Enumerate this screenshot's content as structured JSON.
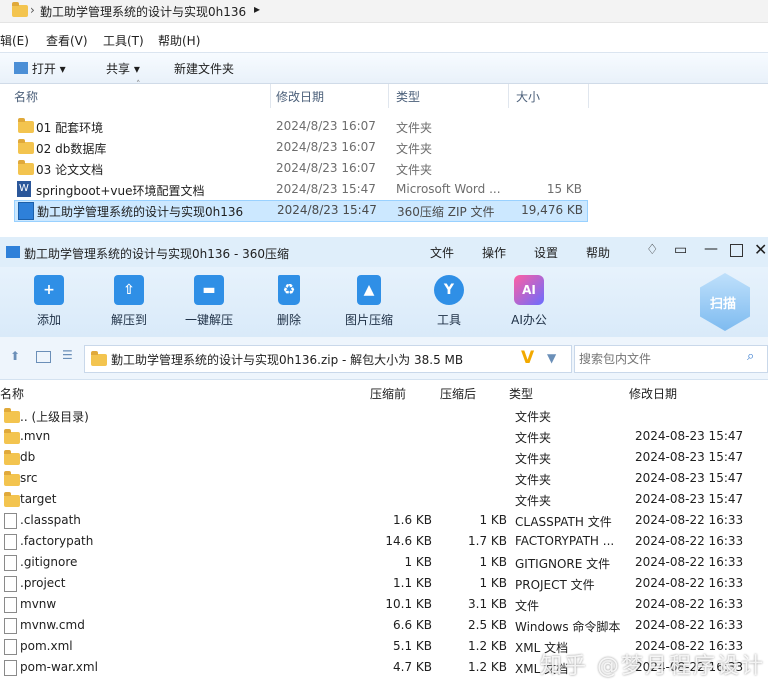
{
  "explorer": {
    "breadcrumb": "勤工助学管理系统的设计与实现0h136",
    "menu": [
      "辑(E)",
      "查看(V)",
      "工具(T)",
      "帮助(H)"
    ],
    "toolbar": {
      "open": "打开",
      "share": "共享",
      "new_folder": "新建文件夹"
    },
    "columns": {
      "name": "名称",
      "date": "修改日期",
      "type": "类型",
      "size": "大小"
    },
    "rows": [
      {
        "name": "01 配套环境",
        "date": "2024/8/23 16:07",
        "type": "文件夹",
        "size": ""
      },
      {
        "name": "02 db数据库",
        "date": "2024/8/23 16:07",
        "type": "文件夹",
        "size": ""
      },
      {
        "name": "03 论文文档",
        "date": "2024/8/23 16:07",
        "type": "文件夹",
        "size": ""
      },
      {
        "name": "springboot+vue环境配置文档",
        "date": "2024/8/23 15:47",
        "type": "Microsoft Word ...",
        "size": "15 KB"
      },
      {
        "name": "勤工助学管理系统的设计与实现0h136",
        "date": "2024/8/23 15:47",
        "type": "360压缩 ZIP 文件",
        "size": "19,476 KB"
      }
    ]
  },
  "zip": {
    "title": "勤工助学管理系统的设计与实现0h136 - 360压缩",
    "menu": {
      "file": "文件",
      "ops": "操作",
      "settings": "设置",
      "help": "帮助"
    },
    "scan": "扫描",
    "ribbon": [
      {
        "label": "添加",
        "icon": "add-icon"
      },
      {
        "label": "解压到",
        "icon": "extract-icon"
      },
      {
        "label": "一键解压",
        "icon": "oneclick-icon"
      },
      {
        "label": "删除",
        "icon": "delete-icon"
      },
      {
        "label": "图片压缩",
        "icon": "image-compress-icon"
      },
      {
        "label": "工具",
        "icon": "tools-icon"
      },
      {
        "label": "AI办公",
        "icon": "ai-icon"
      }
    ],
    "path": "勤工助学管理系统的设计与实现0h136.zip - 解包大小为 38.5 MB",
    "search_placeholder": "搜索包内文件",
    "columns": {
      "name": "名称",
      "packed": "压缩前",
      "compressed": "压缩后",
      "type": "类型",
      "date": "修改日期"
    },
    "rows": [
      {
        "name": ".. (上级目录)",
        "packed": "",
        "compressed": "",
        "type": "文件夹",
        "date": "",
        "kind": "folder"
      },
      {
        "name": ".mvn",
        "packed": "",
        "compressed": "",
        "type": "文件夹",
        "date": "2024-08-23 15:47",
        "kind": "folder"
      },
      {
        "name": "db",
        "packed": "",
        "compressed": "",
        "type": "文件夹",
        "date": "2024-08-23 15:47",
        "kind": "folder"
      },
      {
        "name": "src",
        "packed": "",
        "compressed": "",
        "type": "文件夹",
        "date": "2024-08-23 15:47",
        "kind": "folder"
      },
      {
        "name": "target",
        "packed": "",
        "compressed": "",
        "type": "文件夹",
        "date": "2024-08-23 15:47",
        "kind": "folder"
      },
      {
        "name": ".classpath",
        "packed": "1.6 KB",
        "compressed": "1 KB",
        "type": "CLASSPATH 文件",
        "date": "2024-08-22 16:33",
        "kind": "file"
      },
      {
        "name": ".factorypath",
        "packed": "14.6 KB",
        "compressed": "1.7 KB",
        "type": "FACTORYPATH ...",
        "date": "2024-08-22 16:33",
        "kind": "file"
      },
      {
        "name": ".gitignore",
        "packed": "1 KB",
        "compressed": "1 KB",
        "type": "GITIGNORE 文件",
        "date": "2024-08-22 16:33",
        "kind": "file"
      },
      {
        "name": ".project",
        "packed": "1.1 KB",
        "compressed": "1 KB",
        "type": "PROJECT 文件",
        "date": "2024-08-22 16:33",
        "kind": "file"
      },
      {
        "name": "mvnw",
        "packed": "10.1 KB",
        "compressed": "3.1 KB",
        "type": "文件",
        "date": "2024-08-22 16:33",
        "kind": "file"
      },
      {
        "name": "mvnw.cmd",
        "packed": "6.6 KB",
        "compressed": "2.5 KB",
        "type": "Windows 命令脚本",
        "date": "2024-08-22 16:33",
        "kind": "file"
      },
      {
        "name": "pom.xml",
        "packed": "5.1 KB",
        "compressed": "1.2 KB",
        "type": "XML 文档",
        "date": "2024-08-22 16:33",
        "kind": "file"
      },
      {
        "name": "pom-war.xml",
        "packed": "4.7 KB",
        "compressed": "1.2 KB",
        "type": "XML 文档",
        "date": "2024-08-22 16:33",
        "kind": "file"
      }
    ]
  },
  "watermark": "知乎 @梦月程序设计"
}
